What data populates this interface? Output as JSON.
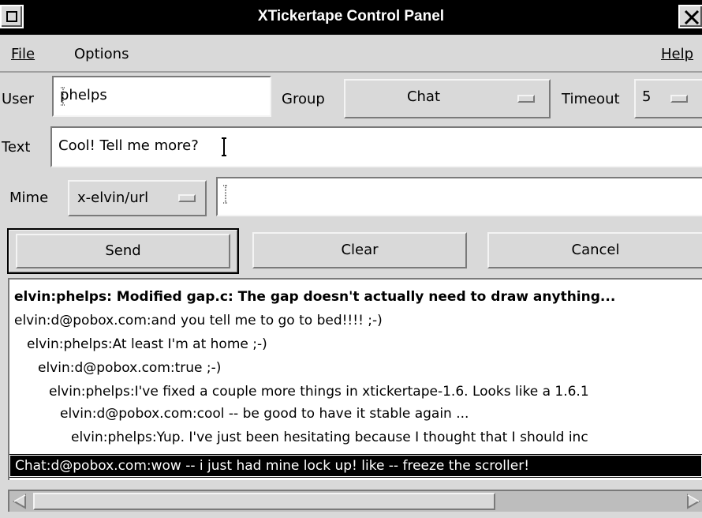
{
  "window": {
    "title": "XTickertape Control Panel"
  },
  "menu": {
    "file": "File",
    "options": "Options",
    "help": "Help"
  },
  "form": {
    "user_label": "User",
    "user_value": "phelps",
    "group_label": "Group",
    "group_value": "Chat",
    "timeout_label": "Timeout",
    "timeout_value": "5",
    "text_label": "Text",
    "text_value": "Cool!  Tell me more?",
    "mime_label": "Mime",
    "mime_value": "x-elvin/url",
    "mime_args_value": ""
  },
  "buttons": {
    "send": "Send",
    "clear": "Clear",
    "cancel": "Cancel"
  },
  "messages": [
    {
      "text": "elvin:phelps: Modified  gap.c: The gap doesn't actually need to draw anything...",
      "indent": 0,
      "style": "bold"
    },
    {
      "text": "elvin:d@pobox.com:and you tell me to go to bed!!!! ;-)",
      "indent": 0,
      "style": "normal"
    },
    {
      "text": "elvin:phelps:At least I'm at home ;-)",
      "indent": 1,
      "style": "normal"
    },
    {
      "text": "elvin:d@pobox.com:true ;-)",
      "indent": 2,
      "style": "normal"
    },
    {
      "text": "elvin:phelps:I've fixed a couple more things in xtickertape-1.6.  Looks like a 1.6.1",
      "indent": 3,
      "style": "normal"
    },
    {
      "text": "elvin:d@pobox.com:cool -- be good to have it stable again ...",
      "indent": 4,
      "style": "normal"
    },
    {
      "text": "elvin:phelps:Yup.  I've just been hesitating because I thought that I should inc",
      "indent": 5,
      "style": "normal"
    },
    {
      "text": "Chat:d@pobox.com:wow -- i just had mine lock up!  like -- freeze the scroller!",
      "indent": 0,
      "style": "selected"
    }
  ],
  "icons": {
    "window_menu": "window-menu-icon",
    "close": "close-icon",
    "option_indicator": "option-menu-indicator-icon",
    "text_cursor": "text-cursor-icon",
    "scroll_left": "scroll-left-arrow-icon",
    "scroll_right": "scroll-right-arrow-icon"
  },
  "colors": {
    "background": "#d9d9d9",
    "titlebar": "#000000",
    "selected_row": "#000000"
  }
}
